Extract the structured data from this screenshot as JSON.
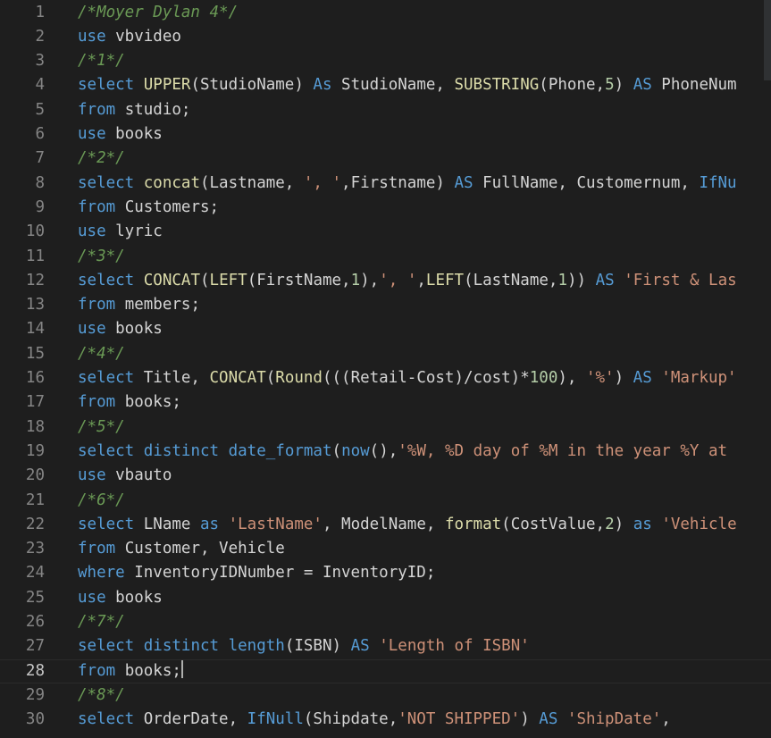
{
  "editor": {
    "colors": {
      "background": "#1e1e1e",
      "keyword": "#569cd6",
      "function": "#dcdcaa",
      "string": "#ce9178",
      "comment": "#6a9955",
      "number": "#b5cea8",
      "text": "#d4d4d4",
      "line_number": "#858585"
    },
    "current_line": 28,
    "lines": [
      {
        "n": "1",
        "tokens": [
          {
            "t": "cmt",
            "v": "/*Moyer Dylan 4*/"
          }
        ]
      },
      {
        "n": "2",
        "tokens": [
          {
            "t": "kw",
            "v": "use"
          },
          {
            "t": "id",
            "v": " vbvideo"
          }
        ]
      },
      {
        "n": "3",
        "tokens": [
          {
            "t": "cmt",
            "v": "/*1*/"
          }
        ]
      },
      {
        "n": "4",
        "tokens": [
          {
            "t": "kw",
            "v": "select"
          },
          {
            "t": "id",
            "v": " "
          },
          {
            "t": "fn",
            "v": "UPPER"
          },
          {
            "t": "id",
            "v": "(StudioName) "
          },
          {
            "t": "kw",
            "v": "As"
          },
          {
            "t": "id",
            "v": " StudioName, "
          },
          {
            "t": "fn",
            "v": "SUBSTRING"
          },
          {
            "t": "id",
            "v": "(Phone,"
          },
          {
            "t": "num",
            "v": "5"
          },
          {
            "t": "id",
            "v": ") "
          },
          {
            "t": "kw",
            "v": "AS"
          },
          {
            "t": "id",
            "v": " PhoneNum"
          }
        ]
      },
      {
        "n": "5",
        "tokens": [
          {
            "t": "kw",
            "v": "from"
          },
          {
            "t": "id",
            "v": " studio;"
          }
        ]
      },
      {
        "n": "6",
        "tokens": [
          {
            "t": "kw",
            "v": "use"
          },
          {
            "t": "id",
            "v": " books"
          }
        ]
      },
      {
        "n": "7",
        "tokens": [
          {
            "t": "cmt",
            "v": "/*2*/"
          }
        ]
      },
      {
        "n": "8",
        "tokens": [
          {
            "t": "kw",
            "v": "select"
          },
          {
            "t": "id",
            "v": " "
          },
          {
            "t": "fn",
            "v": "concat"
          },
          {
            "t": "id",
            "v": "(Lastname, "
          },
          {
            "t": "str",
            "v": "', '"
          },
          {
            "t": "id",
            "v": ",Firstname) "
          },
          {
            "t": "kw",
            "v": "AS"
          },
          {
            "t": "id",
            "v": " FullName, Customernum, "
          },
          {
            "t": "kw",
            "v": "IfNu"
          }
        ]
      },
      {
        "n": "9",
        "tokens": [
          {
            "t": "kw",
            "v": "from"
          },
          {
            "t": "id",
            "v": " Customers;"
          }
        ]
      },
      {
        "n": "10",
        "tokens": [
          {
            "t": "kw",
            "v": "use"
          },
          {
            "t": "id",
            "v": " lyric"
          }
        ]
      },
      {
        "n": "11",
        "tokens": [
          {
            "t": "cmt",
            "v": "/*3*/"
          }
        ]
      },
      {
        "n": "12",
        "tokens": [
          {
            "t": "kw",
            "v": "select"
          },
          {
            "t": "id",
            "v": " "
          },
          {
            "t": "fn",
            "v": "CONCAT"
          },
          {
            "t": "id",
            "v": "("
          },
          {
            "t": "fn",
            "v": "LEFT"
          },
          {
            "t": "id",
            "v": "(FirstName,"
          },
          {
            "t": "num",
            "v": "1"
          },
          {
            "t": "id",
            "v": "),"
          },
          {
            "t": "str",
            "v": "', '"
          },
          {
            "t": "id",
            "v": ","
          },
          {
            "t": "fn",
            "v": "LEFT"
          },
          {
            "t": "id",
            "v": "(LastName,"
          },
          {
            "t": "num",
            "v": "1"
          },
          {
            "t": "id",
            "v": ")) "
          },
          {
            "t": "kw",
            "v": "AS"
          },
          {
            "t": "id",
            "v": " "
          },
          {
            "t": "str",
            "v": "'First & Las"
          }
        ]
      },
      {
        "n": "13",
        "tokens": [
          {
            "t": "kw",
            "v": "from"
          },
          {
            "t": "id",
            "v": " members;"
          }
        ]
      },
      {
        "n": "14",
        "tokens": [
          {
            "t": "kw",
            "v": "use"
          },
          {
            "t": "id",
            "v": " books"
          }
        ]
      },
      {
        "n": "15",
        "tokens": [
          {
            "t": "cmt",
            "v": "/*4*/"
          }
        ]
      },
      {
        "n": "16",
        "tokens": [
          {
            "t": "kw",
            "v": "select"
          },
          {
            "t": "id",
            "v": " Title, "
          },
          {
            "t": "fn",
            "v": "CONCAT"
          },
          {
            "t": "id",
            "v": "("
          },
          {
            "t": "fn",
            "v": "Round"
          },
          {
            "t": "id",
            "v": "(((Retail-Cost)/cost)*"
          },
          {
            "t": "num",
            "v": "100"
          },
          {
            "t": "id",
            "v": "), "
          },
          {
            "t": "str",
            "v": "'%'"
          },
          {
            "t": "id",
            "v": ") "
          },
          {
            "t": "kw",
            "v": "AS"
          },
          {
            "t": "id",
            "v": " "
          },
          {
            "t": "str",
            "v": "'Markup'"
          }
        ]
      },
      {
        "n": "17",
        "tokens": [
          {
            "t": "kw",
            "v": "from"
          },
          {
            "t": "id",
            "v": " books;"
          }
        ]
      },
      {
        "n": "18",
        "tokens": [
          {
            "t": "cmt",
            "v": "/*5*/"
          }
        ]
      },
      {
        "n": "19",
        "tokens": [
          {
            "t": "kw",
            "v": "select"
          },
          {
            "t": "id",
            "v": " "
          },
          {
            "t": "kw",
            "v": "distinct"
          },
          {
            "t": "id",
            "v": " "
          },
          {
            "t": "kw",
            "v": "date_format"
          },
          {
            "t": "id",
            "v": "("
          },
          {
            "t": "kw",
            "v": "now"
          },
          {
            "t": "id",
            "v": "(),"
          },
          {
            "t": "str",
            "v": "'%W, %D day of %M in the year %Y at"
          }
        ]
      },
      {
        "n": "20",
        "tokens": [
          {
            "t": "kw",
            "v": "use"
          },
          {
            "t": "id",
            "v": " vbauto"
          }
        ]
      },
      {
        "n": "21",
        "tokens": [
          {
            "t": "cmt",
            "v": "/*6*/"
          }
        ]
      },
      {
        "n": "22",
        "tokens": [
          {
            "t": "kw",
            "v": "select"
          },
          {
            "t": "id",
            "v": " LName "
          },
          {
            "t": "kw",
            "v": "as"
          },
          {
            "t": "id",
            "v": " "
          },
          {
            "t": "str",
            "v": "'LastName'"
          },
          {
            "t": "id",
            "v": ", ModelName, "
          },
          {
            "t": "fn",
            "v": "format"
          },
          {
            "t": "id",
            "v": "(CostValue,"
          },
          {
            "t": "num",
            "v": "2"
          },
          {
            "t": "id",
            "v": ") "
          },
          {
            "t": "kw",
            "v": "as"
          },
          {
            "t": "id",
            "v": " "
          },
          {
            "t": "str",
            "v": "'Vehicle"
          }
        ]
      },
      {
        "n": "23",
        "tokens": [
          {
            "t": "kw",
            "v": "from"
          },
          {
            "t": "id",
            "v": " Customer, Vehicle"
          }
        ]
      },
      {
        "n": "24",
        "tokens": [
          {
            "t": "kw",
            "v": "where"
          },
          {
            "t": "id",
            "v": " InventoryIDNumber = InventoryID;"
          }
        ]
      },
      {
        "n": "25",
        "tokens": [
          {
            "t": "kw",
            "v": "use"
          },
          {
            "t": "id",
            "v": " books"
          }
        ]
      },
      {
        "n": "26",
        "tokens": [
          {
            "t": "cmt",
            "v": "/*7*/"
          }
        ]
      },
      {
        "n": "27",
        "tokens": [
          {
            "t": "kw",
            "v": "select"
          },
          {
            "t": "id",
            "v": " "
          },
          {
            "t": "kw",
            "v": "distinct"
          },
          {
            "t": "id",
            "v": " "
          },
          {
            "t": "kw",
            "v": "length"
          },
          {
            "t": "id",
            "v": "(ISBN) "
          },
          {
            "t": "kw",
            "v": "AS"
          },
          {
            "t": "id",
            "v": " "
          },
          {
            "t": "str",
            "v": "'Length of ISBN'"
          }
        ]
      },
      {
        "n": "28",
        "tokens": [
          {
            "t": "kw",
            "v": "from"
          },
          {
            "t": "id",
            "v": " books;"
          }
        ]
      },
      {
        "n": "29",
        "tokens": [
          {
            "t": "cmt",
            "v": "/*8*/"
          }
        ]
      },
      {
        "n": "30",
        "tokens": [
          {
            "t": "kw",
            "v": "select"
          },
          {
            "t": "id",
            "v": " OrderDate, "
          },
          {
            "t": "kw",
            "v": "IfNull"
          },
          {
            "t": "id",
            "v": "(Shipdate,"
          },
          {
            "t": "str",
            "v": "'NOT SHIPPED'"
          },
          {
            "t": "id",
            "v": ") "
          },
          {
            "t": "kw",
            "v": "AS"
          },
          {
            "t": "id",
            "v": " "
          },
          {
            "t": "str",
            "v": "'ShipDate'"
          },
          {
            "t": "id",
            "v": ","
          }
        ]
      }
    ]
  }
}
